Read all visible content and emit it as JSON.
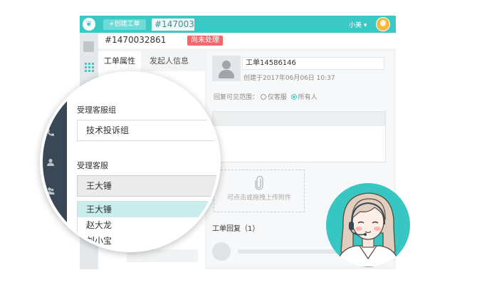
{
  "colors": {
    "accent": "#3cc8c5",
    "badge": "#f2686a",
    "nav_dark": "#3a4756",
    "hover": "#c9ecec"
  },
  "topbar": {
    "logo_glyph": "❦",
    "create_button": "+创建工单",
    "ticket_tab": "#147003",
    "user_name": "小美 ▾"
  },
  "ticket": {
    "id": "#1470032861",
    "status": "尚未处理",
    "tabs": [
      "工单属性",
      "发起人信息"
    ],
    "title": "工单14586146",
    "created": "创建于2017年06月06日 10:37",
    "visibility_label": "回复可见范围：",
    "visibility_options": [
      "仅客服",
      "所有人"
    ],
    "upload_text": "可点击或拖拽上传附件",
    "replies_title": "工单回复（1）"
  },
  "magnifier": {
    "group_label": "受理客服组",
    "group_value": "技术投诉组",
    "agent_label": "受理客服",
    "agent_value": "王大锤",
    "agent_options": [
      "王大锤",
      "赵大龙",
      "刘小宝"
    ]
  }
}
